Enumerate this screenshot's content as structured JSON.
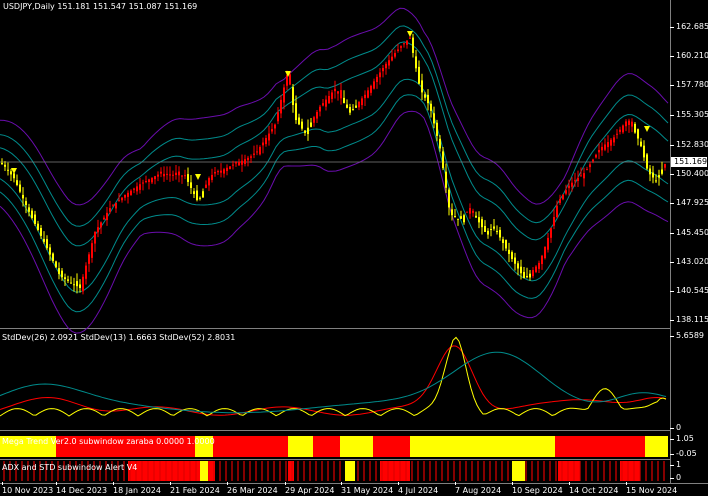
{
  "main": {
    "title": "USDJPY,Daily  151.181 151.547 151.087 151.169",
    "current_price": "151.169",
    "y_ticks": [
      "162.685",
      "160.210",
      "157.780",
      "155.305",
      "152.830",
      "150.400",
      "147.925",
      "145.450",
      "143.020",
      "140.545",
      "138.115"
    ]
  },
  "std_panel": {
    "title": "StdDev(26) 2.0921  StdDev(13) 1.6663  StdDev(52) 2.8031",
    "y_ticks": [
      "5.6589",
      "0"
    ]
  },
  "mega_panel": {
    "title": "Mega Trend Ver2.0 subwindow zaraba 0.0000 1.0000",
    "y_ticks": [
      "1.05",
      "-0.05"
    ]
  },
  "adx_panel": {
    "title": "ADX and STD subwindow Alert V4",
    "y_ticks": [
      "1",
      "0"
    ]
  },
  "x_ticks": [
    "10 Nov 2023",
    "14 Dec 2023",
    "18 Jan 2024",
    "21 Feb 2024",
    "26 Mar 2024",
    "29 Apr 2024",
    "31 May 2024",
    "4 Jul 2024",
    "7 Aug 2024",
    "10 Sep 2024",
    "14 Oct 2024",
    "15 Nov 2024"
  ],
  "colors": {
    "bull": "#ff0000",
    "bear": "#ffff00",
    "band_outer": "#6a0dad",
    "band_inner": "#008b8b",
    "std26": "#ff0000",
    "std13": "#ffff00",
    "std52": "#008b8b"
  },
  "chart_data": {
    "type": "candlestick",
    "title": "USDJPY,Daily",
    "ohlc_last": {
      "open": 151.181,
      "high": 151.547,
      "low": 151.087,
      "close": 151.169
    },
    "series": [
      {
        "name": "StdDev(26)",
        "values": [
          2.0921
        ]
      },
      {
        "name": "StdDev(13)",
        "values": [
          1.6663
        ]
      },
      {
        "name": "StdDev(52)",
        "values": [
          2.8031
        ]
      }
    ],
    "x": [
      "10 Nov 2023",
      "14 Dec 2023",
      "18 Jan 2024",
      "21 Feb 2024",
      "26 Mar 2024",
      "29 Apr 2024",
      "31 May 2024",
      "4 Jul 2024",
      "7 Aug 2024",
      "10 Sep 2024",
      "14 Oct 2024",
      "15 Nov 2024"
    ],
    "close": [
      151.4,
      143.5,
      147.6,
      150.3,
      151.3,
      156.5,
      156.8,
      161.2,
      146.5,
      141.5,
      149.8,
      154.5
    ],
    "ylim": [
      138.115,
      162.685
    ]
  }
}
